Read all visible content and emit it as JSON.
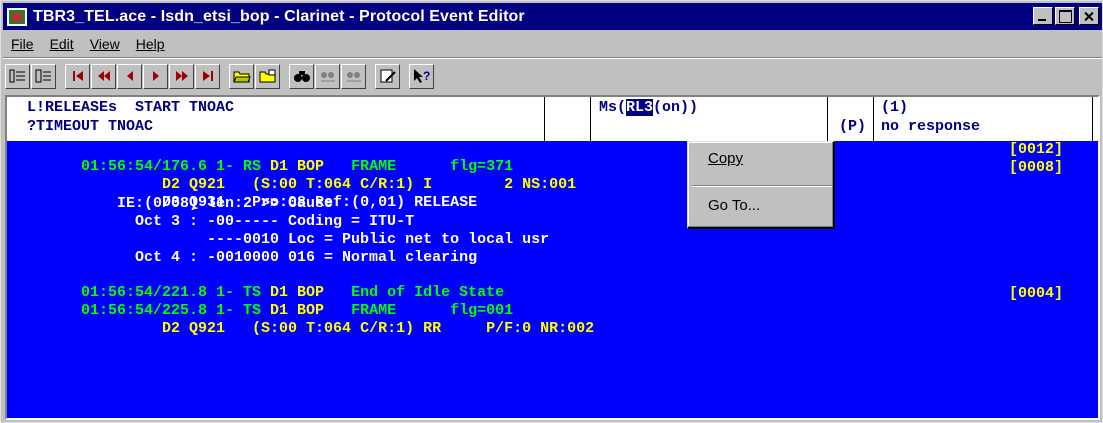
{
  "window": {
    "title": "TBR3_TEL.ace - Isdn_etsi_bop - Clarinet - Protocol Event Editor"
  },
  "menu": {
    "file": "File",
    "edit": "Edit",
    "view": "View",
    "help": "Help"
  },
  "toolbar": {
    "icons": [
      "list-view-icon",
      "tree-view-icon",
      "first-icon",
      "fast-back-icon",
      "back-icon",
      "forward-icon",
      "fast-forward-icon",
      "last-icon",
      "open-folder-icon",
      "save-folder-icon",
      "find-icon",
      "find-prev-icon",
      "find-next-icon",
      "edit-check-icon",
      "context-help-icon"
    ]
  },
  "header": {
    "row1_col1": "L!RELEASEs  START TNOAC",
    "row2_col1": "?TIMEOUT TNOAC",
    "row1_col3_prefix": "Ms(",
    "row1_col3_selected": "RL3",
    "row1_col3_suffix": "(on))",
    "row2_col4": "(P)",
    "row1_col5": "(1)",
    "row2_col5": "no response"
  },
  "log": {
    "lines": [
      {
        "time": "01:56:54/176.6 1- RS",
        "layer": " D1 BOP   ",
        "text": "FRAME      flg=371",
        "ref": "[0012]"
      },
      {
        "time": "",
        "layer": "         D2 Q921   ",
        "text": "(S:00 T:064 C/R:1) I        2 NS:001",
        "ref": "[0008]"
      },
      {
        "time": "",
        "layer": "         D3 Q931   ",
        "text": "Pro:08 Ref:(0,01) RELEASE",
        "ref": ""
      },
      {
        "time": "",
        "layer": "",
        "text": "            IE:(0/08) len:2 >> Cause",
        "ref": ""
      },
      {
        "time": "",
        "layer": "",
        "text": "              Oct 3 : -00----- Coding = ITU-T",
        "ref": ""
      },
      {
        "time": "",
        "layer": "",
        "text": "                      ----0010 Loc = Public net to local usr",
        "ref": ""
      },
      {
        "time": "",
        "layer": "",
        "text": "              Oct 4 : -0010000 016 = Normal clearing",
        "ref": ""
      },
      {
        "time": "01:56:54/221.8 1- TS",
        "layer": " D1 BOP   ",
        "text": "End of Idle State",
        "ref": ""
      },
      {
        "time": "01:56:54/225.8 1- TS",
        "layer": " D1 BOP   ",
        "text": "FRAME      flg=001",
        "ref": "[0004]"
      },
      {
        "time": "",
        "layer": "         D2 Q921   ",
        "text": "(S:00 T:064 C/R:1) RR     P/F:0 NR:002",
        "ref": ""
      }
    ]
  },
  "context_menu": {
    "copy": "Copy",
    "goto": "Go To..."
  },
  "colors": {
    "titlebar": "#000080",
    "log_background": "#0000ff",
    "time_color": "#00ff00",
    "layer_color": "#ffff00",
    "text_color": "#ffffff"
  }
}
